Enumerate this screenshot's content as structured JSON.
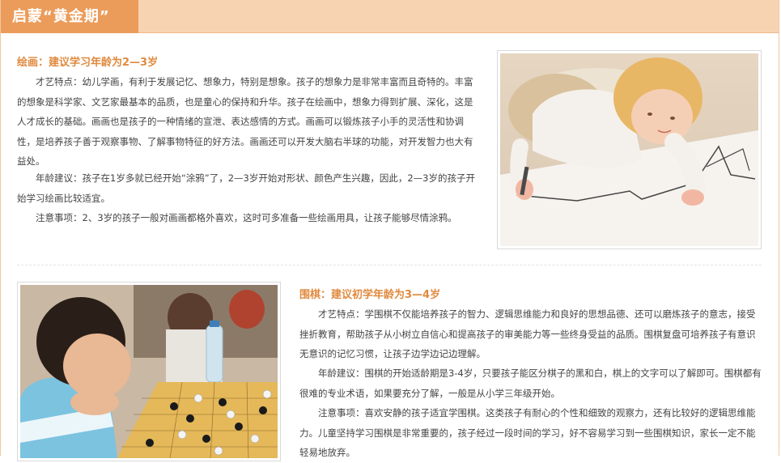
{
  "header": {
    "title": "启蒙“黄金期”"
  },
  "painting": {
    "title": "绘画：建议学习年龄为2—3岁",
    "p1": "才艺特点：幼儿学画，有利于发展记忆、想象力，特别是想象。孩子的想象力是非常丰富而且奇特的。丰富的想象是科学家、文艺家最基本的品质，也是童心的保持和升华。孩子在绘画中，想象力得到扩展、深化，这是人才成长的基础。画画也是孩子的一种情绪的宣泄、表达感情的方式。画画可以锻炼孩子小手的灵活性和协调性，是培养孩子善于观察事物、了解事物特征的好方法。画画还可以开发大脑右半球的功能，对开发智力也大有益处。",
    "p2": "年龄建议：孩子在1岁多就已经开始“涂鸦”了，2—3岁开始对形状、颜色产生兴趣，因此，2—3岁的孩子开始学习绘画比较适宜。",
    "p3": "注意事项：2、3岁的孩子一般对画画都格外喜欢，这时可多准备一些绘画用具，让孩子能够尽情涂鸦。"
  },
  "weiqi": {
    "title": "围棋：建议初学年龄为3—4岁",
    "p1": "才艺特点：学围棋不仅能培养孩子的智力、逻辑思维能力和良好的思想品德、还可以磨炼孩子的意志，接受挫折教育，帮助孩子从小树立自信心和提高孩子的审美能力等一些终身受益的品质。围棋复盘可培养孩子有意识无意识的记忆习惯，让孩子边学边记边理解。",
    "p2": "年龄建议：围棋的开始适龄期是3-4岁，只要孩子能区分棋子的黑和白，棋上的文字可以了解即可。围棋都有很难的专业术语，如果要充分了解，一般是从小学三年级开始。",
    "p3": "注意事项：喜欢安静的孩子适宜学围棋。这类孩子有耐心的个性和细致的观察力，还有比较好的逻辑思维能力。儿童坚持学习围棋是非常重要的，孩子经过一段时间的学习，好不容易学习到一些围棋知识，家长一定不能轻易地放弃。"
  }
}
